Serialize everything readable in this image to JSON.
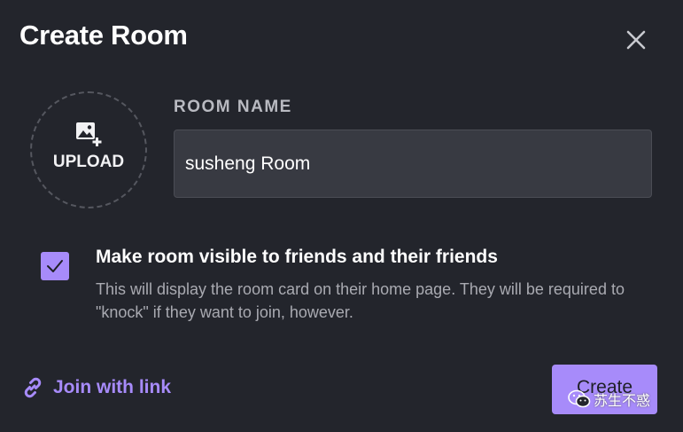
{
  "dialog": {
    "title": "Create Room",
    "close_icon": "close-icon"
  },
  "upload": {
    "label": "UPLOAD",
    "icon": "add-image-icon"
  },
  "room_name": {
    "label": "ROOM NAME",
    "value": "susheng Room"
  },
  "visibility": {
    "checked": true,
    "title": "Make room visible to friends and their friends",
    "description": "This will display the room card on their home page. They will be required to \"knock\" if they want to join, however."
  },
  "footer": {
    "join_link_label": "Join with link",
    "join_link_icon": "link-icon",
    "create_label": "Create"
  },
  "watermark": {
    "text": "苏生不惑",
    "icon": "wechat-icon"
  },
  "colors": {
    "background": "#23252c",
    "accent": "#a78bfa",
    "input_bg": "#383a42",
    "muted_text": "#a9aab1"
  }
}
